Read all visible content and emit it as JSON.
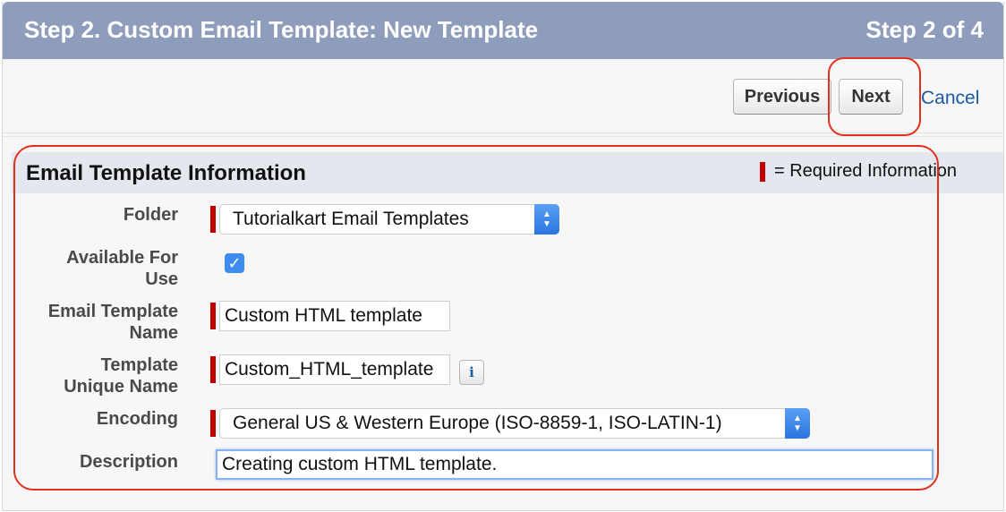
{
  "header": {
    "title": "Step 2. Custom Email Template: New Template",
    "step": "Step 2 of 4"
  },
  "toolbar": {
    "previous_label": "Previous",
    "next_label": "Next",
    "cancel_label": "Cancel"
  },
  "section": {
    "title": "Email Template Information",
    "required_legend": "= Required Information"
  },
  "fields": {
    "folder": {
      "label": "Folder",
      "value": "Tutorialkart Email Templates"
    },
    "available": {
      "label_line1": "Available For",
      "label_line2": "Use",
      "checked": true,
      "check_glyph": "✓"
    },
    "name": {
      "label_line1": "Email Template",
      "label_line2": "Name",
      "value": "Custom HTML template"
    },
    "unique_name": {
      "label_line1": "Template",
      "label_line2": "Unique Name",
      "value": "Custom_HTML_template",
      "info_glyph": "i"
    },
    "encoding": {
      "label": "Encoding",
      "value": "General US & Western Europe (ISO-8859-1, ISO-LATIN-1)"
    },
    "description": {
      "label": "Description",
      "value": "Creating custom HTML template."
    }
  },
  "icons": {
    "select_arrows": "select-arrows-icon",
    "info": "info-icon",
    "checkmark": "checkmark-icon"
  },
  "colors": {
    "header": "#8f9dbd",
    "required": "#c00000",
    "link": "#1b5aa6",
    "annotation": "#e0301e",
    "checkbox": "#3c8cf0"
  }
}
